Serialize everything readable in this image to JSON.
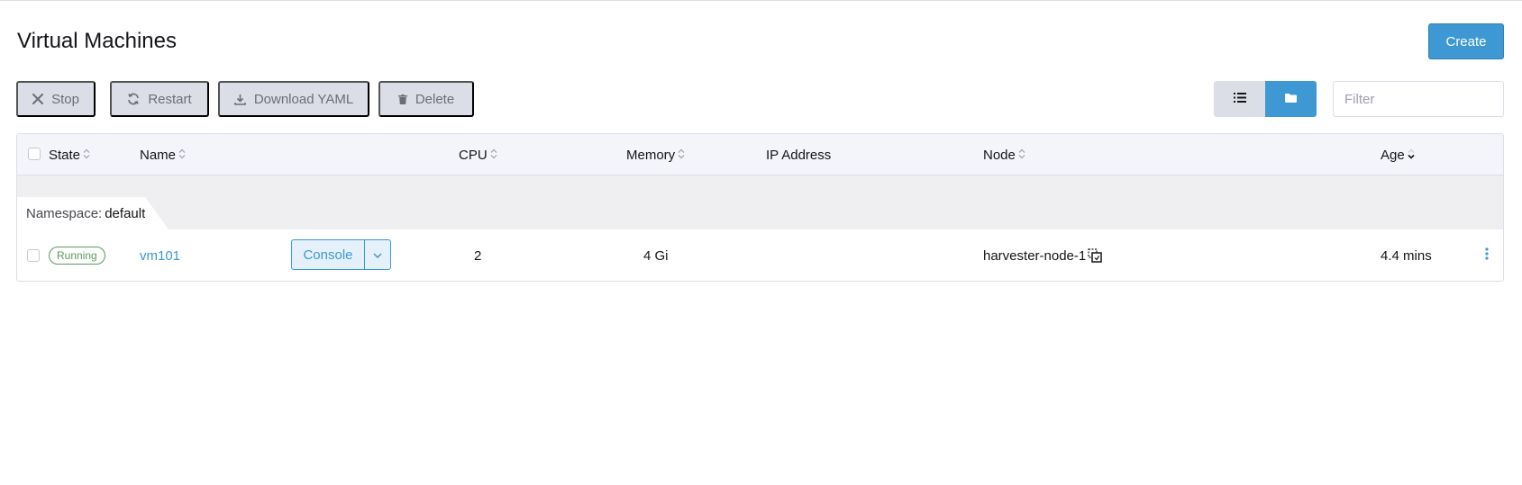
{
  "page": {
    "title": "Virtual Machines",
    "create_label": "Create"
  },
  "toolbar": {
    "stop_label": "Stop",
    "restart_label": "Restart",
    "download_yaml_label": "Download YAML",
    "delete_label": "Delete",
    "filter_placeholder": "Filter"
  },
  "table": {
    "headers": {
      "state": "State",
      "name": "Name",
      "cpu": "CPU",
      "memory": "Memory",
      "ip_address": "IP Address",
      "node": "Node",
      "age": "Age"
    },
    "group": {
      "label": "Namespace:",
      "value": "default"
    },
    "rows": [
      {
        "state": "Running",
        "name": "vm101",
        "console_label": "Console",
        "cpu": "2",
        "memory": "4 Gi",
        "ip_address": "",
        "node": "harvester-node-1",
        "age": "4.4 mins"
      }
    ]
  },
  "colors": {
    "accent": "#3d98d3",
    "running": "#5d995d",
    "button_disabled": "#dcdee7"
  },
  "icons": {
    "stop": "close-icon",
    "restart": "refresh-icon",
    "download": "download-icon",
    "delete": "trash-icon",
    "list_view": "list-icon",
    "group_view": "folder-icon",
    "copy": "copy-icon",
    "menu": "kebab-icon"
  }
}
